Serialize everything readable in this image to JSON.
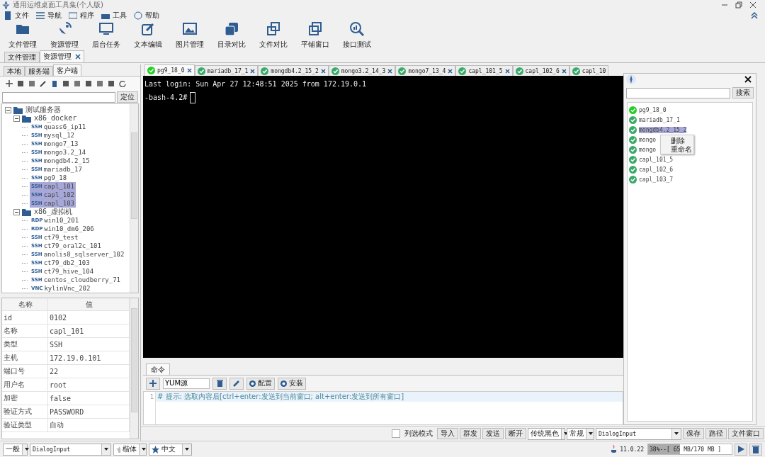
{
  "window": {
    "title": "通用运维桌面工具集(个人版)"
  },
  "menu": [
    "文件",
    "导航",
    "程序",
    "工具",
    "帮助"
  ],
  "toolbar": [
    "文件管理",
    "资源管理",
    "后台任务",
    "文本编辑",
    "图片管理",
    "目录对比",
    "文件对比",
    "平铺窗口",
    "接口测试"
  ],
  "doc_tabs": [
    {
      "label": "文件管理",
      "selected": false,
      "closable": false
    },
    {
      "label": "资源管理",
      "selected": true,
      "closable": true
    }
  ],
  "left_tabs": [
    {
      "label": "本地",
      "selected": false
    },
    {
      "label": "服务端",
      "selected": false
    },
    {
      "label": "客户端",
      "selected": true
    }
  ],
  "locate_button": "定位",
  "tree": [
    {
      "label": "测试服务器",
      "kind": "folder",
      "expanded": true,
      "children": [
        {
          "label": "x86_docker",
          "kind": "folder",
          "expanded": true,
          "children": [
            {
              "label": "quass6_ip11",
              "kind": "leaf",
              "badge": "SSH",
              "selected": false
            },
            {
              "label": "mysql_12",
              "kind": "leaf",
              "badge": "SSH",
              "selected": false
            },
            {
              "label": "mongo7_13",
              "kind": "leaf",
              "badge": "SSH",
              "selected": false
            },
            {
              "label": "mongo3.2_14",
              "kind": "leaf",
              "badge": "SSH",
              "selected": false
            },
            {
              "label": "mongdb4.2_15",
              "kind": "leaf",
              "badge": "SSH",
              "selected": false
            },
            {
              "label": "mariadb_17",
              "kind": "leaf",
              "badge": "SSH",
              "selected": false
            },
            {
              "label": "pg9_18",
              "kind": "leaf",
              "badge": "SSH",
              "selected": false
            },
            {
              "label": "capl_101",
              "kind": "leaf",
              "badge": "SSH",
              "selected": true
            },
            {
              "label": "capl_102",
              "kind": "leaf",
              "badge": "SSH",
              "selected": true
            },
            {
              "label": "capl_103",
              "kind": "leaf",
              "badge": "SSH",
              "selected": true
            }
          ]
        },
        {
          "label": "x86_虚拟机",
          "kind": "folder",
          "expanded": true,
          "children": [
            {
              "label": "win10_201",
              "kind": "leaf",
              "badge": "RDP",
              "selected": false
            },
            {
              "label": "win10_dm6_206",
              "kind": "leaf",
              "badge": "RDP",
              "selected": false
            },
            {
              "label": "ct79_test",
              "kind": "leaf",
              "badge": "SSH",
              "selected": false
            },
            {
              "label": "ct79_oral2c_101",
              "kind": "leaf",
              "badge": "SSH",
              "selected": false
            },
            {
              "label": "anolis8_sqlserver_102",
              "kind": "leaf",
              "badge": "SSH",
              "selected": false
            },
            {
              "label": "ct79_db2_103",
              "kind": "leaf",
              "badge": "SSH",
              "selected": false
            },
            {
              "label": "ct79_hive_104",
              "kind": "leaf",
              "badge": "SSH",
              "selected": false
            },
            {
              "label": "centos_cloudberry_71",
              "kind": "leaf",
              "badge": "SSH",
              "selected": false
            },
            {
              "label": "kylinVnc_202",
              "kind": "leaf",
              "badge": "VNC",
              "selected": false
            }
          ]
        }
      ]
    }
  ],
  "properties": {
    "columns": [
      "名称",
      "值"
    ],
    "rows": [
      {
        "name": "id",
        "value": "0102"
      },
      {
        "name": "名称",
        "value": "capl_101"
      },
      {
        "name": "类型",
        "value": "SSH"
      },
      {
        "name": "主机",
        "value": "172.19.0.101"
      },
      {
        "name": "端口号",
        "value": "22"
      },
      {
        "name": "用户名",
        "value": "root"
      },
      {
        "name": "加密",
        "value": "false"
      },
      {
        "name": "验证方式",
        "value": "PASSWORD"
      },
      {
        "name": "验证类型",
        "value": "自动"
      }
    ]
  },
  "terminal_tabs": [
    {
      "label": "pg9_18_0",
      "selected": true
    },
    {
      "label": "mariadb_17_1",
      "selected": false
    },
    {
      "label": "mongdb4.2_15_2",
      "selected": false
    },
    {
      "label": "mongo3.2_14_3",
      "selected": false
    },
    {
      "label": "mongo7_13_4",
      "selected": false
    },
    {
      "label": "capl_101_5",
      "selected": false
    },
    {
      "label": "capl_102_6",
      "selected": false
    },
    {
      "label": "capl_10",
      "selected": false
    }
  ],
  "terminal": {
    "lines": [
      "Last login: Sun Apr 27 12:48:51 2025 from 172.19.0.1",
      "-bash-4.2#"
    ]
  },
  "command": {
    "tab": "命令",
    "input": "YUM源",
    "buttons": [
      "配置",
      "安装"
    ],
    "line_number": "1",
    "hint": "# 提示: 选取内容后[ctrl+enter:发送到当前窗口; alt+enter:发送到所有窗口]"
  },
  "bottom_bar": {
    "checkbox": {
      "label": "列选模式",
      "checked": false
    },
    "buttons": [
      "导入",
      "群发",
      "发送",
      "断开"
    ],
    "theme": "传统黑色",
    "style": "常规",
    "font": "DialogInput",
    "right_buttons": [
      "保存",
      "路径",
      "文件窗口"
    ]
  },
  "session_panel": {
    "search_button": "搜索",
    "sessions": [
      {
        "label": "pg9_18_0",
        "active": true,
        "selected": false
      },
      {
        "label": "mariadb_17_1",
        "active": false,
        "selected": false
      },
      {
        "label": "mongdb4.2_15_2",
        "active": false,
        "selected": true
      },
      {
        "label": "mongo",
        "active": false,
        "selected": false
      },
      {
        "label": "mongo",
        "active": false,
        "selected": false
      },
      {
        "label": "capl_101_5",
        "active": false,
        "selected": false
      },
      {
        "label": "capl_102_6",
        "active": false,
        "selected": false
      },
      {
        "label": "capl_103_7",
        "active": false,
        "selected": false
      }
    ],
    "context_menu": [
      "删除",
      "重命名"
    ]
  },
  "status_bar": {
    "level_select": "一般",
    "font": "DialogInput",
    "font_style": "楷体",
    "language": "中文",
    "java_version": "11.0.22",
    "memory": {
      "text": "38%--[ 65 MB/170 MB ]",
      "level": 0.38
    }
  }
}
